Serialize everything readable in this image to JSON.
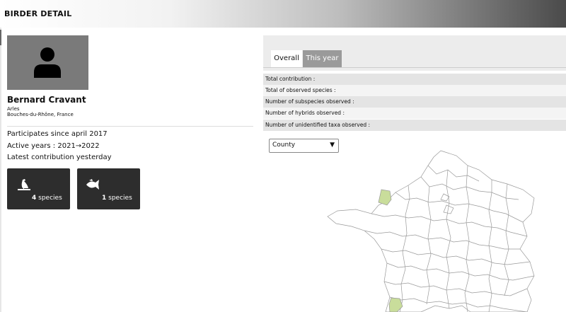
{
  "header": {
    "title": "BIRDER DETAIL"
  },
  "profile": {
    "name": "Bernard Cravant",
    "city": "Arles",
    "region": "Bouches-du-Rhône, France",
    "participates": "Participates since april 2017",
    "active_years": "Active years : 2021→2022",
    "latest": "Latest contribution yesterday"
  },
  "cards": [
    {
      "icon": "bird-icon",
      "count": "4",
      "unit": "species"
    },
    {
      "icon": "fish-icon",
      "count": "1",
      "unit": "species"
    }
  ],
  "tabs": [
    {
      "label": "Overall",
      "active": true
    },
    {
      "label": "This year",
      "active": false
    }
  ],
  "stats": [
    {
      "label": "Total contribution :"
    },
    {
      "label": "Total of observed species :"
    },
    {
      "label": "Number of subspecies observed :"
    },
    {
      "label": "Number of hybrids observed :"
    },
    {
      "label": "Number of unidentified taxa observed :"
    }
  ],
  "map_filter": {
    "selected": "County"
  },
  "colors": {
    "highlight_region": "#c9dd9b",
    "card_bg": "#2d2d2d",
    "avatar_bg": "#7a7a7a"
  }
}
